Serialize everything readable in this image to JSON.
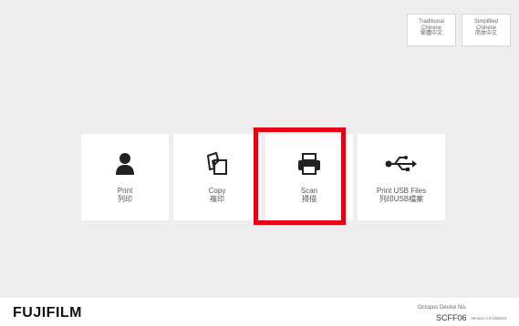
{
  "language_buttons": [
    {
      "line1": "Traditional",
      "line2": "Chinese",
      "line3": "繁體中文"
    },
    {
      "line1": "Simplified",
      "line2": "Chinese",
      "line3": "简体中文"
    }
  ],
  "tiles": [
    {
      "title": "Print",
      "subtitle": "列印",
      "icon": "person-icon"
    },
    {
      "title": "Copy",
      "subtitle": "複印",
      "icon": "copy-icon"
    },
    {
      "title": "Scan",
      "subtitle": "掃描",
      "icon": "printer-icon"
    },
    {
      "title": "Print USB Files",
      "subtitle": "列印USB檔案",
      "icon": "usb-icon"
    }
  ],
  "highlight_color": "#e60012",
  "footer": {
    "logo": "FUJIFILM",
    "device_label": "Octopus Device No.",
    "device_id": "SCFF06",
    "version": "Version 4.0-255503"
  }
}
